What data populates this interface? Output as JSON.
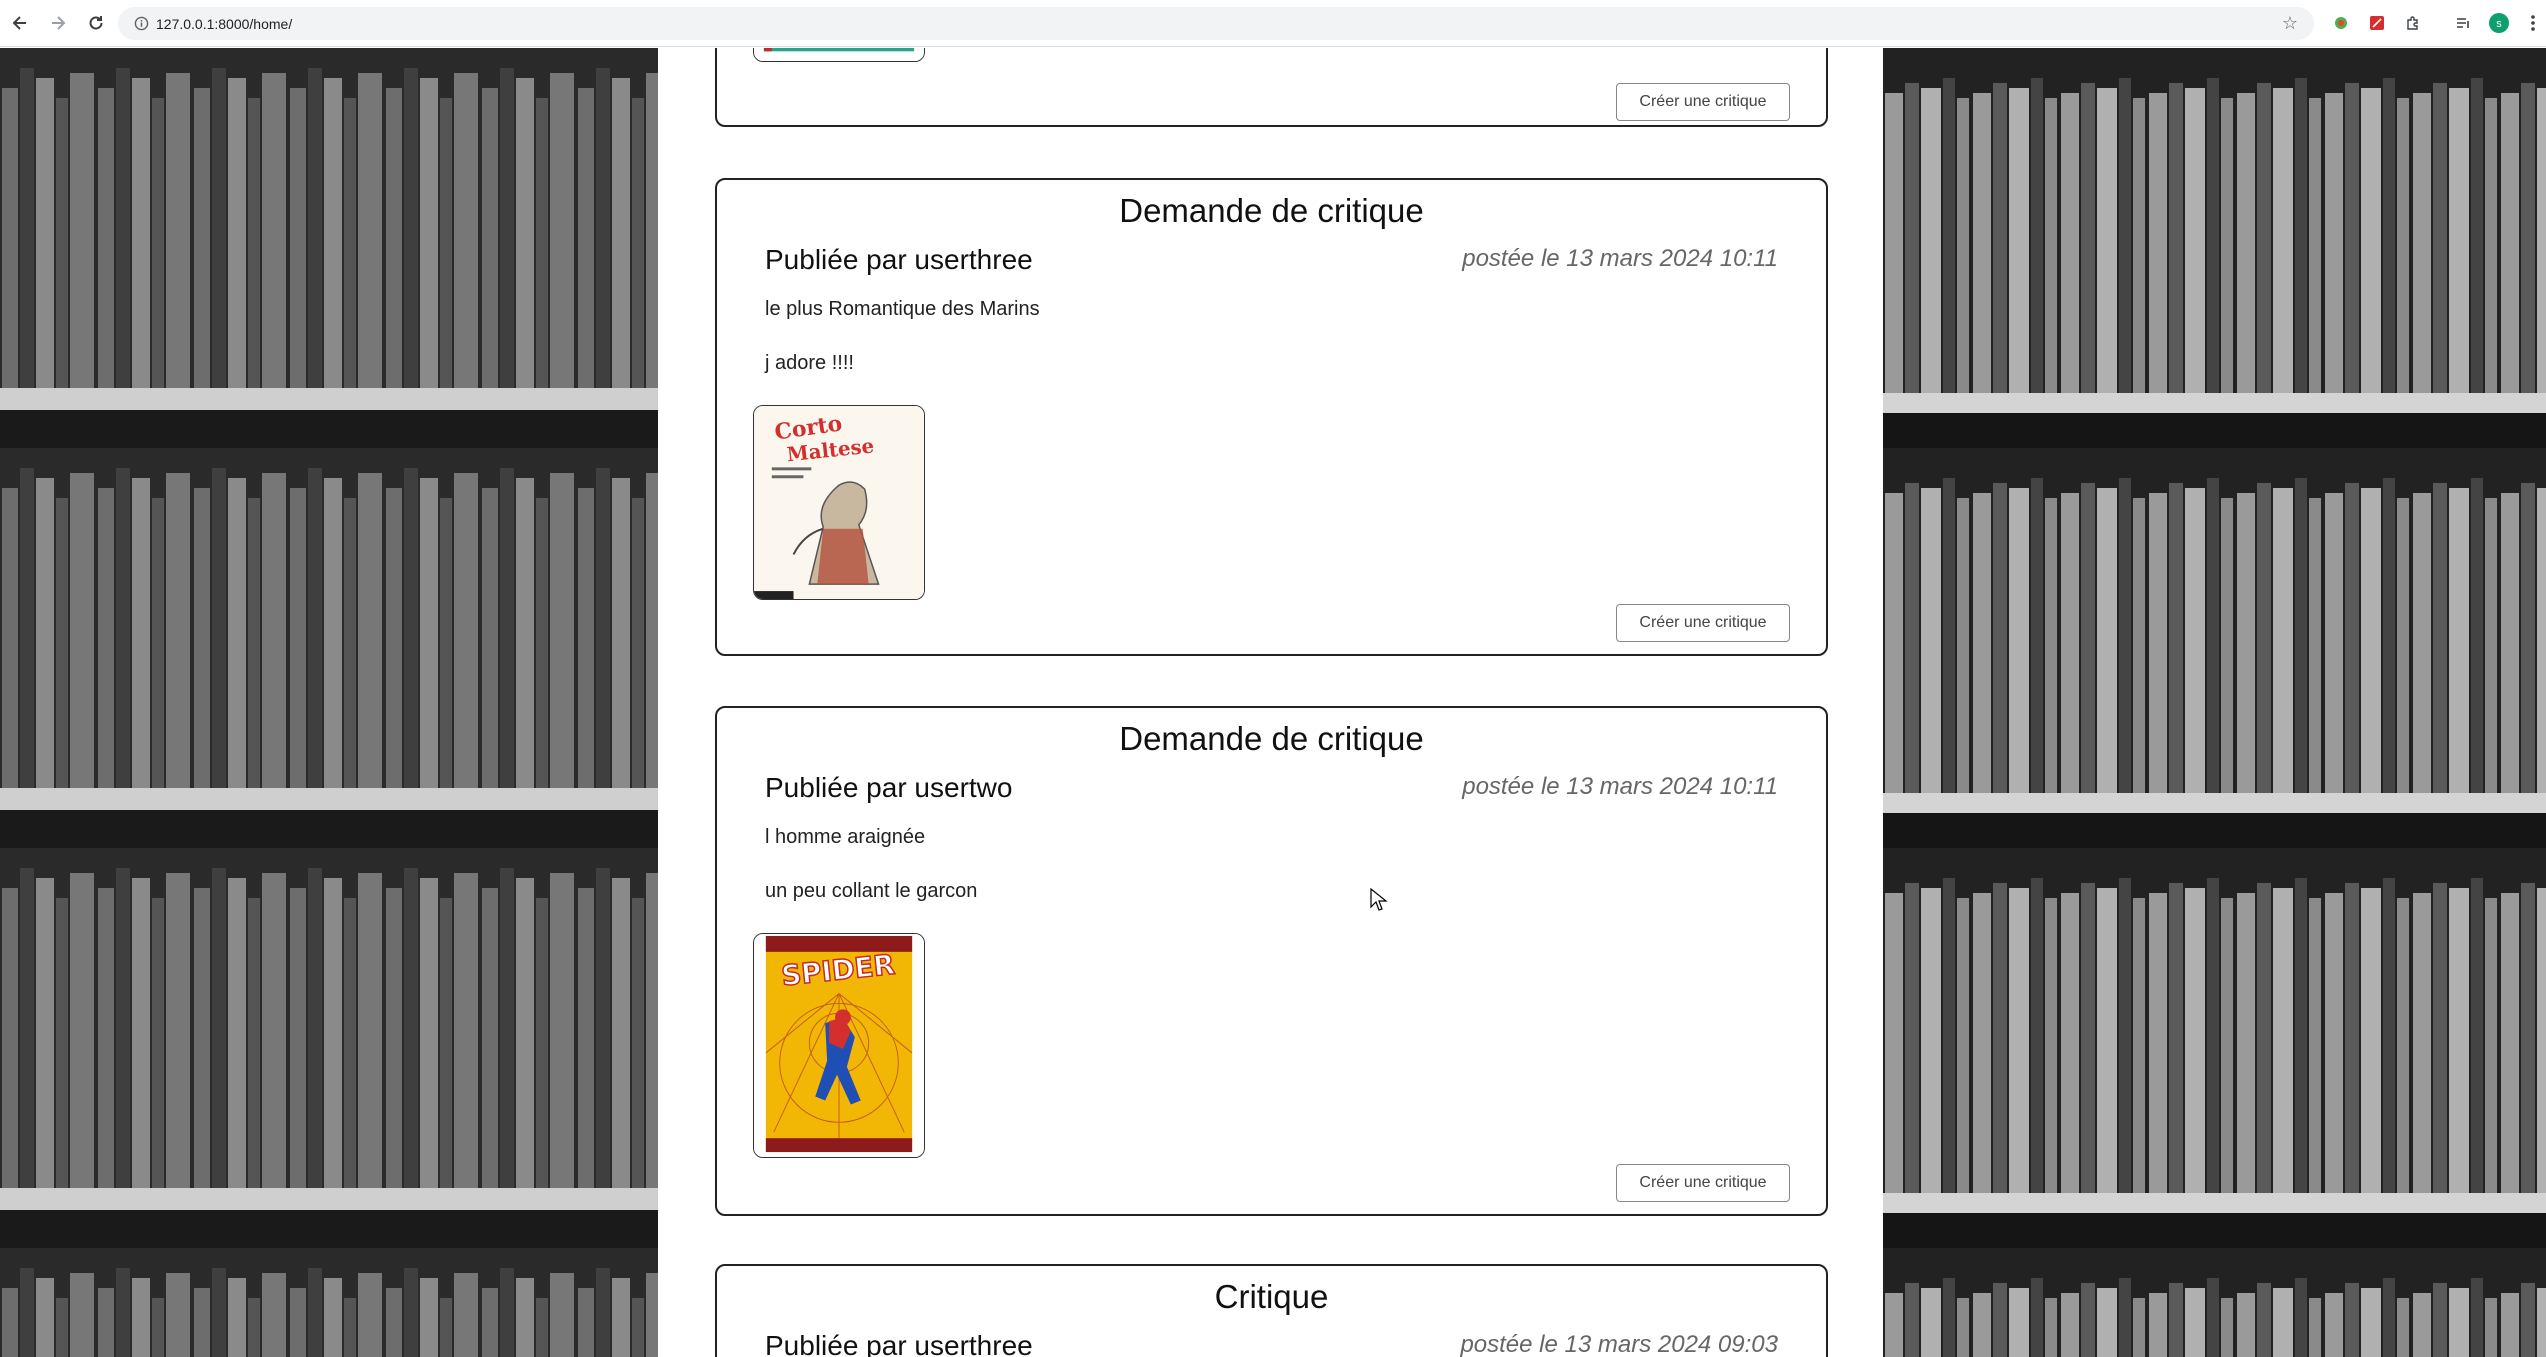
{
  "browser": {
    "url": "127.0.0.1:8000/home/",
    "profile_initial": "s"
  },
  "feed": {
    "top_card": {
      "button": "Créer une critique"
    },
    "posts": [
      {
        "title": "Demande de critique",
        "author": "Publiée par userthree",
        "date": "postée le 13 mars 2024 10:11",
        "book_title": "le plus Romantique des Marins",
        "description": "j adore !!!!",
        "button": "Créer une critique",
        "cover": "corto-maltese-cover"
      },
      {
        "title": "Demande de critique",
        "author": "Publiée par usertwo",
        "date": "postée le 13 mars 2024 10:11",
        "book_title": "l homme araignée",
        "description": "un peu collant le garcon",
        "button": "Créer une critique",
        "cover": "spider-man-cover"
      },
      {
        "title": "Critique",
        "author": "Publiée par userthree",
        "date": "postée le 13 mars 2024 09:03"
      }
    ]
  },
  "colors": {
    "card_border": "#222222",
    "date_text": "#666666",
    "omnibox_bg": "#f1f3f4"
  }
}
